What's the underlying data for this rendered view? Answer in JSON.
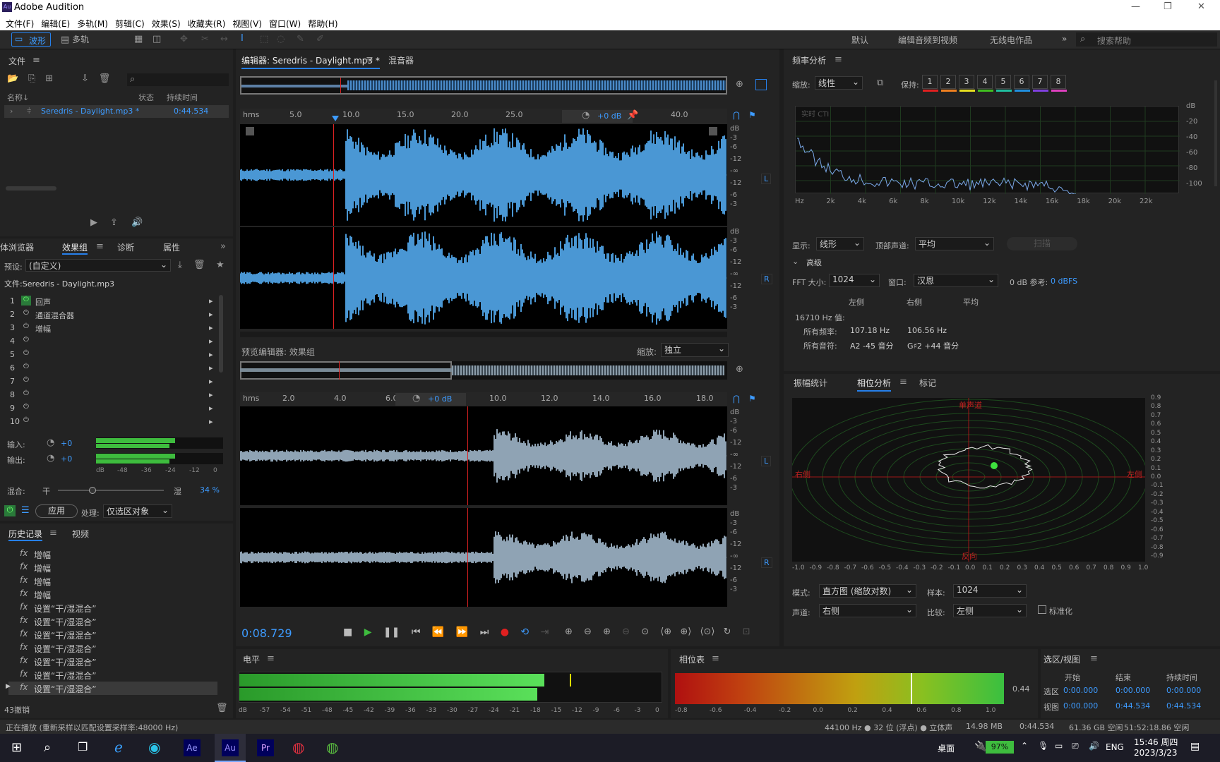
{
  "window": {
    "title": "Adobe Audition",
    "minimize": "—",
    "maximize": "❐",
    "close": "✕"
  },
  "menu": [
    "文件(F)",
    "编辑(E)",
    "多轨(M)",
    "剪辑(C)",
    "效果(S)",
    "收藏夹(R)",
    "视图(V)",
    "窗口(W)",
    "帮助(H)"
  ],
  "toolbar": {
    "waveform": "波形",
    "multitrack": "多轨",
    "workspaces": [
      "默认",
      "编辑音频到视频",
      "无线电作品"
    ],
    "search_placeholder": "搜索帮助"
  },
  "files_panel": {
    "title": "文件",
    "columns": [
      "名称",
      "状态",
      "持续时间"
    ],
    "file_name": "Seredris - Daylight.mp3 *",
    "file_duration": "0:44.534"
  },
  "effects_panel": {
    "tabs": [
      "体浏览器",
      "效果组",
      "诊断",
      "属性"
    ],
    "preset_label": "预设:",
    "preset_value": "(自定义)",
    "file_label": "文件:Seredris - Daylight.mp3",
    "rows": [
      {
        "n": "1",
        "name": "回声"
      },
      {
        "n": "2",
        "name": "通道混合器"
      },
      {
        "n": "3",
        "name": "增幅"
      },
      {
        "n": "4",
        "name": ""
      },
      {
        "n": "5",
        "name": ""
      },
      {
        "n": "6",
        "name": ""
      },
      {
        "n": "7",
        "name": ""
      },
      {
        "n": "8",
        "name": ""
      },
      {
        "n": "9",
        "name": ""
      },
      {
        "n": "10",
        "name": ""
      }
    ],
    "input_label": "输入:",
    "output_label": "输出:",
    "input_val": "+0",
    "output_val": "+0",
    "meter_ticks": [
      "dB",
      "-48",
      "-36",
      "-24",
      "-12",
      "0"
    ],
    "mix_label": "混合:",
    "dry": "干",
    "wet": "湿",
    "mix_pct": "34 %",
    "apply": "应用",
    "process_label": "处理:",
    "process_value": "仅选区对象"
  },
  "history_panel": {
    "tabs": [
      "历史记录",
      "视频"
    ],
    "items": [
      "增幅",
      "增幅",
      "增幅",
      "增幅",
      "设置“干/湿混合”",
      "设置“干/湿混合”",
      "设置“干/湿混合”",
      "设置“干/湿混合”",
      "设置“干/湿混合”",
      "设置“干/湿混合”",
      "设置“干/湿混合”"
    ],
    "undo_count": "43撤销"
  },
  "editor": {
    "tab_editor": "编辑器: Seredris - Daylight.mp3 *",
    "tab_mixer": "混音器",
    "ruler_unit": "hms",
    "ruler_ticks": [
      "5.0",
      "10.0",
      "15.0",
      "20.0",
      "25.0",
      "40.0"
    ],
    "gain": "+0 dB",
    "db_labels": [
      "dB",
      "-3",
      "-6",
      "-12",
      "-∞",
      "-12",
      "-6",
      "-3"
    ],
    "ch_left": "L",
    "ch_right": "R"
  },
  "preview": {
    "title": "预览编辑器: 效果组",
    "zoom_label": "缩放:",
    "zoom_value": "独立",
    "ruler_ticks": [
      "2.0",
      "4.0",
      "6.0",
      "10.0",
      "12.0",
      "14.0",
      "16.0",
      "18.0"
    ],
    "gain": "+0 dB"
  },
  "transport": {
    "time": "0:08.729"
  },
  "freq_panel": {
    "title": "频率分析",
    "scale_label": "缩放:",
    "scale_value": "线性",
    "hold_label": "保持:",
    "holds": [
      "1",
      "2",
      "3",
      "4",
      "5",
      "6",
      "7",
      "8"
    ],
    "hold_colors": [
      "#e02020",
      "#f08020",
      "#e8e020",
      "#40c020",
      "#20c0a0",
      "#2090e0",
      "#8040e0",
      "#e040c0"
    ],
    "overlay": "实时 CTI",
    "y_ticks": [
      "dB",
      "-20",
      "-40",
      "-60",
      "-80",
      "-100"
    ],
    "x_ticks": [
      "Hz",
      "2k",
      "4k",
      "6k",
      "8k",
      "10k",
      "12k",
      "14k",
      "16k",
      "18k",
      "20k",
      "22k"
    ],
    "display_label": "显示:",
    "display_value": "线形",
    "top_channel_label": "顶部声道:",
    "top_channel_value": "平均",
    "scan": "扫描",
    "advanced": "高级",
    "fft_label": "FFT 大小:",
    "fft_value": "1024",
    "window_label": "窗口:",
    "window_value": "汉恩",
    "ref_label": "0 dB 参考:",
    "ref_value": "0 dBFS",
    "cols": [
      "左侧",
      "右侧",
      "平均"
    ],
    "row1_label": "16710 Hz 值:",
    "row2_label": "所有频率:",
    "row2_left": "107.18 Hz",
    "row2_right": "106.56 Hz",
    "row3_label": "所有音符:",
    "row3_left": "A2 -45 音分",
    "row3_right": "G♯2 +44 音分"
  },
  "phase_panel": {
    "tabs": [
      "振幅统计",
      "相位分析",
      "标记"
    ],
    "top_label": "单声道",
    "left_label": "右侧",
    "right_label": "左侧",
    "bottom_label": "反向",
    "x_ticks": [
      "-1.0",
      "-0.9",
      "-0.8",
      "-0.7",
      "-0.6",
      "-0.5",
      "-0.4",
      "-0.3",
      "-0.2",
      "-0.1",
      "0.0",
      "0.1",
      "0.2",
      "0.3",
      "0.4",
      "0.5",
      "0.6",
      "0.7",
      "0.8",
      "0.9",
      "1.0"
    ],
    "y_ticks": [
      "0.9",
      "0.8",
      "0.7",
      "0.6",
      "0.5",
      "0.4",
      "0.3",
      "0.2",
      "0.1",
      "0.0",
      "-0.1",
      "-0.2",
      "-0.3",
      "-0.4",
      "-0.5",
      "-0.6",
      "-0.7",
      "-0.8",
      "-0.9"
    ],
    "mode_label": "模式:",
    "mode_value": "直方图 (缩放对数)",
    "sample_label": "样本:",
    "sample_value": "1024",
    "channel_label": "声道:",
    "channel_value": "右侧",
    "compare_label": "比较:",
    "compare_value": "左侧",
    "normalize": "标准化"
  },
  "level_panel": {
    "title": "电平",
    "ticks": [
      "dB",
      "-57",
      "-54",
      "-51",
      "-48",
      "-45",
      "-42",
      "-39",
      "-36",
      "-33",
      "-30",
      "-27",
      "-24",
      "-21",
      "-18",
      "-15",
      "-12",
      "-9",
      "-6",
      "-3",
      "0"
    ]
  },
  "phasemeter": {
    "title": "相位表",
    "ticks": [
      "-0.8",
      "-0.6",
      "-0.4",
      "-0.2",
      "0.0",
      "0.2",
      "0.4",
      "0.6",
      "0.8",
      "1.0"
    ],
    "value": "0.44"
  },
  "selection": {
    "title": "选区/视图",
    "cols": [
      "开始",
      "结束",
      "持续时间"
    ],
    "sel_label": "选区",
    "view_label": "视图",
    "sel": [
      "0:00.000",
      "0:00.000",
      "0:00.000"
    ],
    "view": [
      "0:00.000",
      "0:44.534",
      "0:44.534"
    ]
  },
  "status": {
    "left": "正在播放 (重新采样以匹配设置采样率:48000 Hz)",
    "rate": "44100 Hz ● 32 位 (浮点) ● 立体声",
    "size": "14.98 MB",
    "dur": "0:44.534",
    "free": "61.36 GB 空闲",
    "time": "51:52:18.86 空闲"
  },
  "taskbar": {
    "desktop": "桌面",
    "battery": "97%",
    "lang": "ENG",
    "clock_time": "15:46 周四",
    "clock_date": "2023/3/23",
    "apps": [
      "Ae",
      "Au",
      "Pr"
    ]
  }
}
